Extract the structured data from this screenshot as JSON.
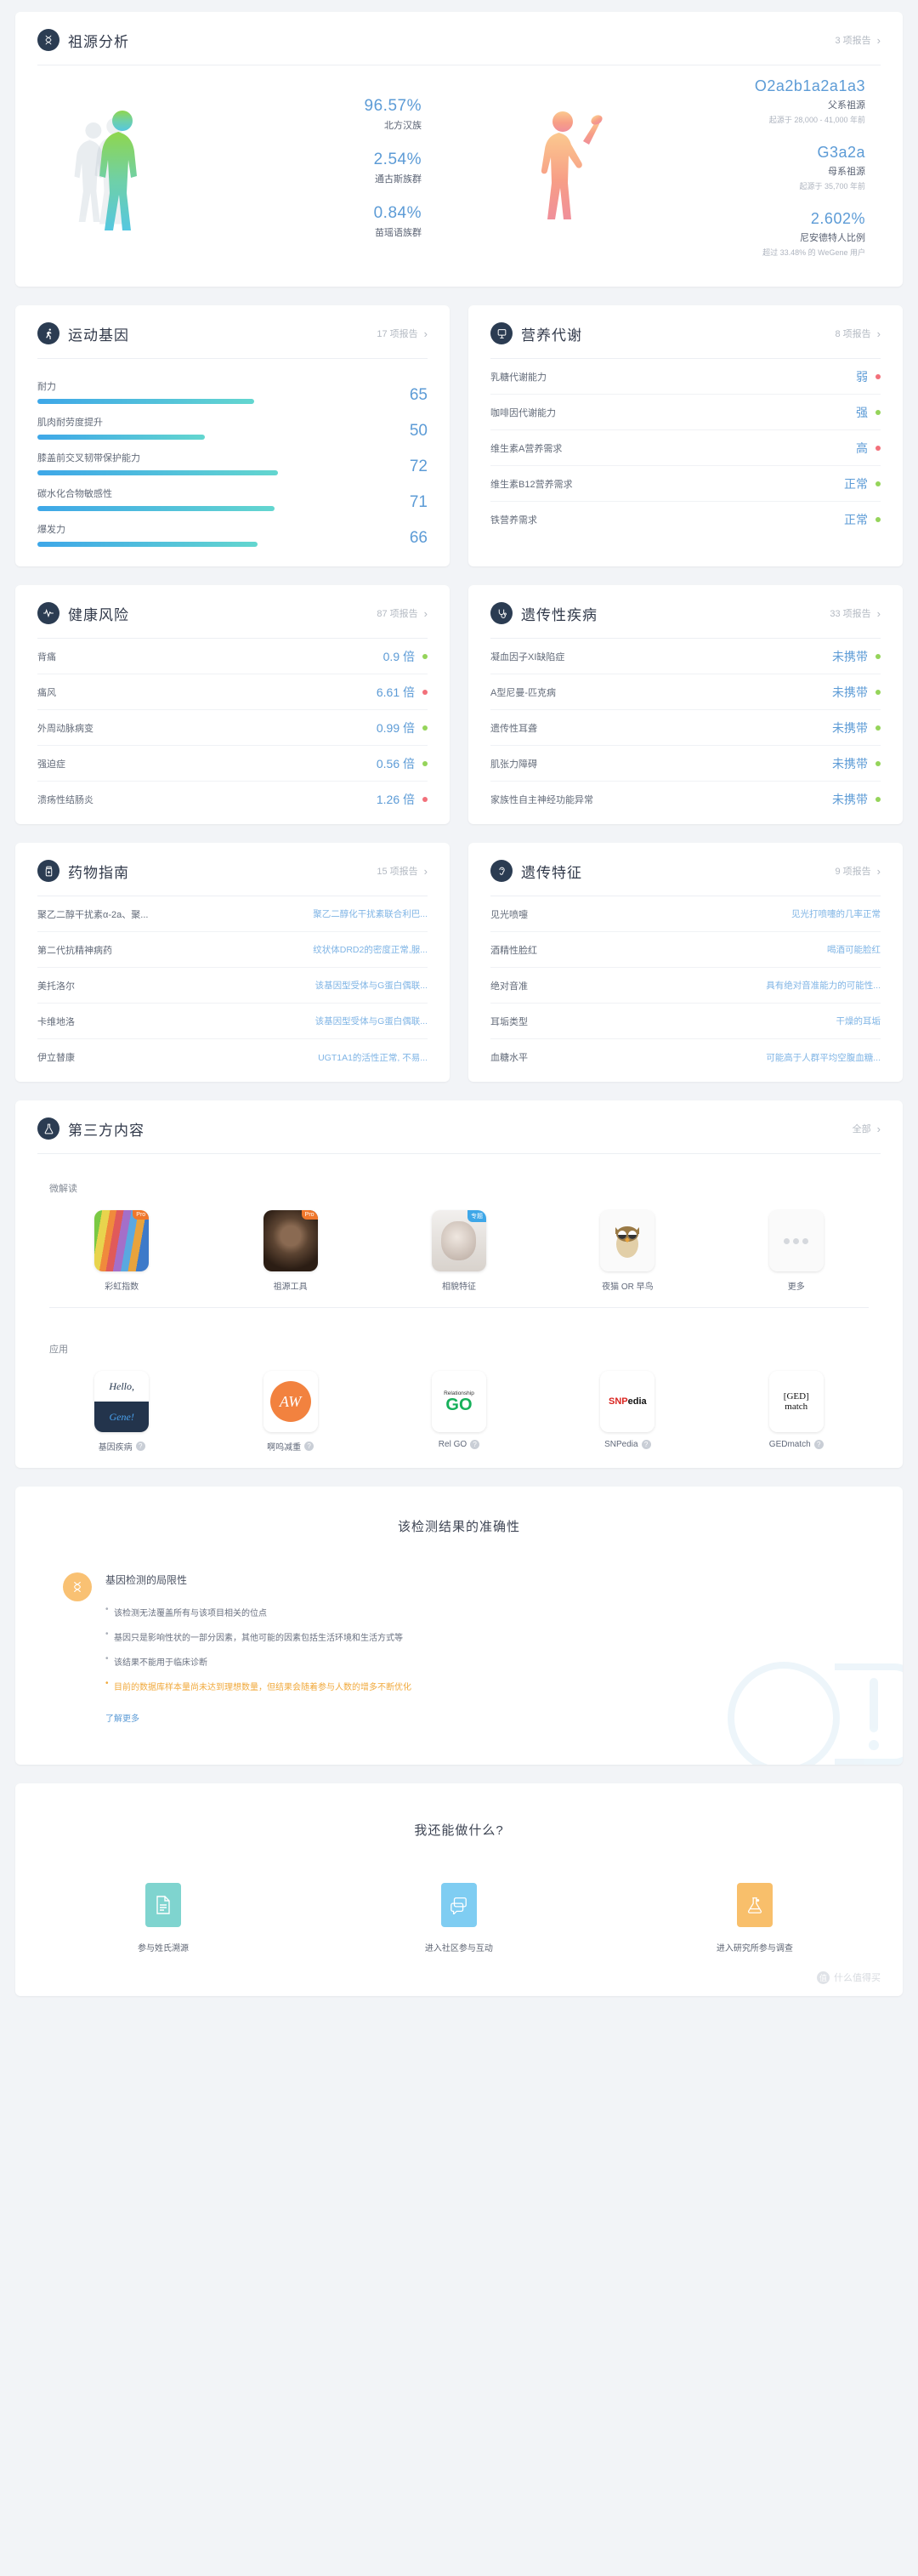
{
  "ancestry": {
    "title": "祖源分析",
    "icon": "ancestry-icon",
    "reports": "3 项报告",
    "left": [
      {
        "value": "96.57%",
        "label": "北方汉族"
      },
      {
        "value": "2.54%",
        "label": "通古斯族群"
      },
      {
        "value": "0.84%",
        "label": "苗瑶语族群"
      }
    ],
    "right": [
      {
        "value": "O2a2b1a2a1a3",
        "label": "父系祖源",
        "note": "起源于 28,000 - 41,000 年前"
      },
      {
        "value": "G3a2a",
        "label": "母系祖源",
        "note": "起源于 35,700 年前"
      },
      {
        "value": "2.602%",
        "label": "尼安德特人比例",
        "note": "超过 33.48% 的 WeGene 用户"
      }
    ]
  },
  "sports": {
    "title": "运动基因",
    "reports": "17 项报告",
    "items": [
      {
        "label": "耐力",
        "value": 65
      },
      {
        "label": "肌肉耐劳度提升",
        "value": 50
      },
      {
        "label": "膝盖前交叉韧带保护能力",
        "value": 72
      },
      {
        "label": "碳水化合物敏感性",
        "value": 71
      },
      {
        "label": "爆发力",
        "value": 66
      }
    ]
  },
  "nutrition": {
    "title": "营养代谢",
    "reports": "8 项报告",
    "items": [
      {
        "label": "乳糖代谢能力",
        "value": "弱",
        "status": "#f2707a"
      },
      {
        "label": "咖啡因代谢能力",
        "value": "强",
        "status": "#95d45a"
      },
      {
        "label": "维生素A营养需求",
        "value": "高",
        "status": "#f2707a"
      },
      {
        "label": "维生素B12营养需求",
        "value": "正常",
        "status": "#95d45a"
      },
      {
        "label": "铁营养需求",
        "value": "正常",
        "status": "#95d45a"
      }
    ]
  },
  "healthrisk": {
    "title": "健康风险",
    "reports": "87 项报告",
    "items": [
      {
        "label": "背痛",
        "value": "0.9 倍",
        "status": "#95d45a"
      },
      {
        "label": "痛风",
        "value": "6.61 倍",
        "status": "#f2707a"
      },
      {
        "label": "外周动脉病变",
        "value": "0.99 倍",
        "status": "#95d45a"
      },
      {
        "label": "强迫症",
        "value": "0.56 倍",
        "status": "#95d45a"
      },
      {
        "label": "溃疡性结肠炎",
        "value": "1.26 倍",
        "status": "#f2707a"
      }
    ]
  },
  "genetic_disease": {
    "title": "遗传性疾病",
    "reports": "33 项报告",
    "items": [
      {
        "label": "凝血因子XI缺陷症",
        "value": "未携带",
        "status": "#95d45a"
      },
      {
        "label": "A型尼曼-匹克病",
        "value": "未携带",
        "status": "#95d45a"
      },
      {
        "label": "遗传性耳聋",
        "value": "未携带",
        "status": "#95d45a"
      },
      {
        "label": "肌张力障碍",
        "value": "未携带",
        "status": "#95d45a"
      },
      {
        "label": "家族性自主神经功能异常",
        "value": "未携带",
        "status": "#95d45a"
      }
    ]
  },
  "drug_guide": {
    "title": "药物指南",
    "reports": "15 项报告",
    "items": [
      {
        "label": "聚乙二醇干扰素α-2a、聚...",
        "value": "聚乙二醇化干扰素联合利巴..."
      },
      {
        "label": "第二代抗精神病药",
        "value": "纹状体DRD2的密度正常,服..."
      },
      {
        "label": "美托洛尔",
        "value": "该基因型受体与G蛋白偶联..."
      },
      {
        "label": "卡维地洛",
        "value": "该基因型受体与G蛋白偶联..."
      },
      {
        "label": "伊立替康",
        "value": "UGT1A1的活性正常, 不易..."
      }
    ]
  },
  "traits": {
    "title": "遗传特征",
    "reports": "9 项报告",
    "items": [
      {
        "label": "见光喷嚏",
        "value": "见光打喷嚏的几率正常"
      },
      {
        "label": "酒精性脸红",
        "value": "喝酒可能脸红"
      },
      {
        "label": "绝对音准",
        "value": "具有绝对音准能力的可能性..."
      },
      {
        "label": "耳垢类型",
        "value": "干燥的耳垢"
      },
      {
        "label": "血糖水平",
        "value": "可能高于人群平均空腹血糖..."
      }
    ]
  },
  "thirdparty": {
    "title": "第三方内容",
    "reports": "全部",
    "groups": [
      {
        "label": "微解读",
        "items": [
          {
            "name": "彩虹指数",
            "badge": "Pro",
            "badge_type": "pro",
            "thumb": "rainbow"
          },
          {
            "name": "祖源工具",
            "badge": "Pro",
            "badge_type": "pro",
            "thumb": "neander"
          },
          {
            "name": "相貌特征",
            "badge": "专题",
            "badge_type": "topic",
            "thumb": "face"
          },
          {
            "name": "夜猫 OR 早鸟",
            "badge": "",
            "badge_type": "",
            "thumb": "owl"
          },
          {
            "name": "更多",
            "badge": "",
            "badge_type": "",
            "thumb": "more"
          }
        ]
      },
      {
        "label": "应用",
        "items": [
          {
            "name": "基因疾病",
            "help": "?",
            "thumb": "hello-gene",
            "logo_top": "Hello,",
            "logo_bot": "Gene!"
          },
          {
            "name": "啊呜减重",
            "help": "?",
            "thumb": "aw",
            "logo_top": "AW",
            "logo_bot": ""
          },
          {
            "name": "Rel GO",
            "help": "?",
            "thumb": "relgo",
            "logo_top": "Relationship",
            "logo_bot": "GO"
          },
          {
            "name": "SNPedia",
            "help": "?",
            "thumb": "snpedia",
            "logo_top": "SNP",
            "logo_bot": "edia"
          },
          {
            "name": "GEDmatch",
            "help": "?",
            "thumb": "gedmatch",
            "logo_top": "[GED]",
            "logo_bot": "match"
          }
        ]
      }
    ]
  },
  "accuracy": {
    "title": "该检测结果的准确性",
    "subtitle": "基因检测的局限性",
    "points": [
      "该检测无法覆盖所有与该项目相关的位点",
      "基因只是影响性状的一部分因素，其他可能的因素包括生活环境和生活方式等",
      "该结果不能用于临床诊断"
    ],
    "warning": "目前的数据库样本量尚未达到理想数量，但结果会随着参与人数的增多不断优化",
    "more": "了解更多"
  },
  "whatelse": {
    "title": "我还能做什么?",
    "items": [
      {
        "label": "参与姓氏溯源",
        "color": "#7fd4cf",
        "icon": "document-icon"
      },
      {
        "label": "进入社区参与互动",
        "color": "#7fcdf2",
        "icon": "chat-icon"
      },
      {
        "label": "进入研究所参与调查",
        "color": "#f8bf6b",
        "icon": "flask-icon"
      }
    ],
    "watermark": "什么值得买",
    "watermark_mark": "值"
  }
}
